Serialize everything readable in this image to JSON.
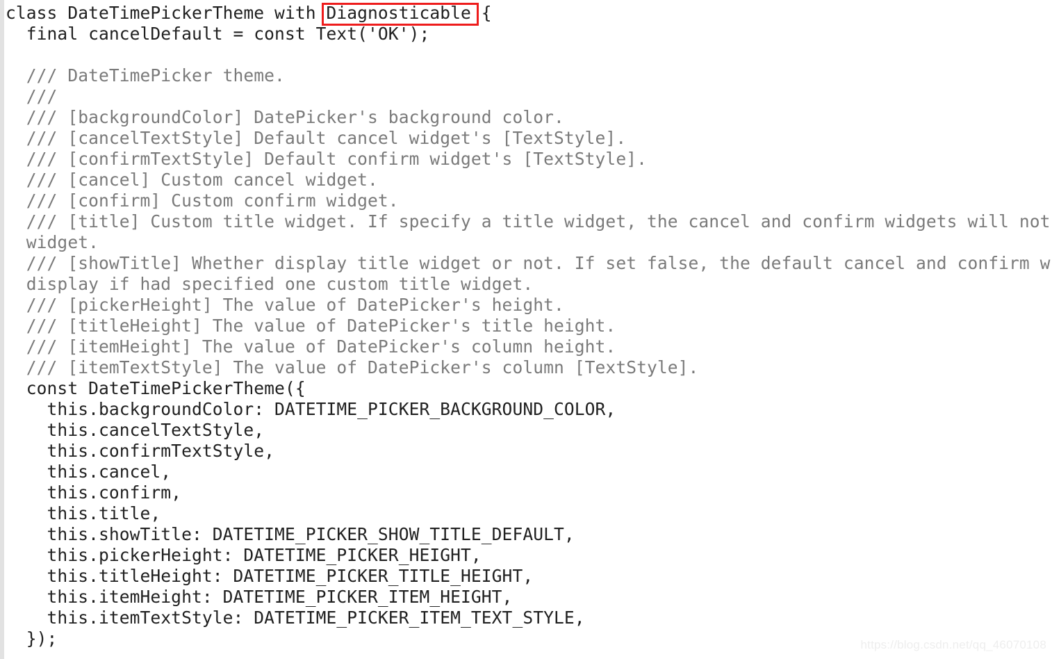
{
  "editor": {
    "background_color": "#ffffff",
    "code_color": "#202020",
    "comment_color": "#7a7a7a",
    "gutter_color": "#e2e2e2",
    "language": "dart"
  },
  "annotation": {
    "type": "rectangle",
    "color": "#ee1c1c",
    "target_text": "Diagnosticable"
  },
  "watermark": {
    "text": "https://blog.csdn.net/qq_46070108",
    "color": "#eeeeee"
  },
  "code": {
    "lines": [
      {
        "text": "class DateTimePickerTheme with Diagnosticable {",
        "kind": "code"
      },
      {
        "text": "  final cancelDefault = const Text('OK');",
        "kind": "code"
      },
      {
        "text": "",
        "kind": "blank"
      },
      {
        "text": "  /// DateTimePicker theme.",
        "kind": "comment"
      },
      {
        "text": "  ///",
        "kind": "comment"
      },
      {
        "text": "  /// [backgroundColor] DatePicker's background color.",
        "kind": "comment"
      },
      {
        "text": "  /// [cancelTextStyle] Default cancel widget's [TextStyle].",
        "kind": "comment"
      },
      {
        "text": "  /// [confirmTextStyle] Default confirm widget's [TextStyle].",
        "kind": "comment"
      },
      {
        "text": "  /// [cancel] Custom cancel widget.",
        "kind": "comment"
      },
      {
        "text": "  /// [confirm] Custom confirm widget.",
        "kind": "comment"
      },
      {
        "text": "  /// [title] Custom title widget. If specify a title widget, the cancel and confirm widgets will not",
        "kind": "comment"
      },
      {
        "text": "  widget.",
        "kind": "comment"
      },
      {
        "text": "  /// [showTitle] Whether display title widget or not. If set false, the default cancel and confirm w",
        "kind": "comment"
      },
      {
        "text": "  display if had specified one custom title widget.",
        "kind": "comment"
      },
      {
        "text": "  /// [pickerHeight] The value of DatePicker's height.",
        "kind": "comment"
      },
      {
        "text": "  /// [titleHeight] The value of DatePicker's title height.",
        "kind": "comment"
      },
      {
        "text": "  /// [itemHeight] The value of DatePicker's column height.",
        "kind": "comment"
      },
      {
        "text": "  /// [itemTextStyle] The value of DatePicker's column [TextStyle].",
        "kind": "comment"
      },
      {
        "text": "  const DateTimePickerTheme({",
        "kind": "code"
      },
      {
        "text": "    this.backgroundColor: DATETIME_PICKER_BACKGROUND_COLOR,",
        "kind": "code"
      },
      {
        "text": "    this.cancelTextStyle,",
        "kind": "code"
      },
      {
        "text": "    this.confirmTextStyle,",
        "kind": "code"
      },
      {
        "text": "    this.cancel,",
        "kind": "code"
      },
      {
        "text": "    this.confirm,",
        "kind": "code"
      },
      {
        "text": "    this.title,",
        "kind": "code"
      },
      {
        "text": "    this.showTitle: DATETIME_PICKER_SHOW_TITLE_DEFAULT,",
        "kind": "code"
      },
      {
        "text": "    this.pickerHeight: DATETIME_PICKER_HEIGHT,",
        "kind": "code"
      },
      {
        "text": "    this.titleHeight: DATETIME_PICKER_TITLE_HEIGHT,",
        "kind": "code"
      },
      {
        "text": "    this.itemHeight: DATETIME_PICKER_ITEM_HEIGHT,",
        "kind": "code"
      },
      {
        "text": "    this.itemTextStyle: DATETIME_PICKER_ITEM_TEXT_STYLE,",
        "kind": "code"
      },
      {
        "text": "  });",
        "kind": "code"
      }
    ]
  }
}
